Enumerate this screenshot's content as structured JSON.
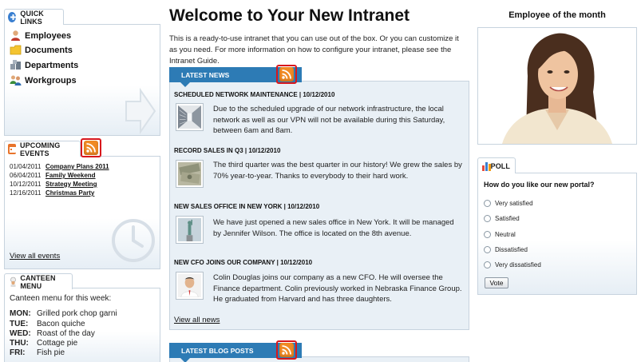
{
  "quick_links": {
    "title": "QUICK LINKS",
    "items": [
      {
        "label": "Employees",
        "icon": "user-icon"
      },
      {
        "label": "Documents",
        "icon": "folder-icon"
      },
      {
        "label": "Departments",
        "icon": "boxes-icon"
      },
      {
        "label": "Workgroups",
        "icon": "group-icon"
      }
    ]
  },
  "upcoming_events": {
    "title": "UPCOMING EVENTS",
    "items": [
      {
        "date": "01/04/2011",
        "title": "Company Plans 2011"
      },
      {
        "date": "06/04/2011",
        "title": "Family Weekend"
      },
      {
        "date": "10/12/2011",
        "title": "Strategy Meeting"
      },
      {
        "date": "12/16/2011",
        "title": "Christmas Party"
      }
    ],
    "view_all": "View all events"
  },
  "canteen": {
    "title": "CANTEEN MENU",
    "intro": "Canteen menu for this week:",
    "items": [
      {
        "day": "MON:",
        "dish": "Grilled pork chop garni"
      },
      {
        "day": "TUE:",
        "dish": "Bacon quiche"
      },
      {
        "day": "WED:",
        "dish": "Roast of the day"
      },
      {
        "day": "THU:",
        "dish": "Cottage pie"
      },
      {
        "day": "FRI:",
        "dish": "Fish pie"
      }
    ]
  },
  "main": {
    "title": "Welcome to Your New Intranet",
    "intro": "This is a ready-to-use intranet that you can use out of the box. Or you can customize it as you need. For more information on how to configure your intranet, please see the Intranet Guide."
  },
  "latest_news": {
    "title": "LATEST NEWS",
    "items": [
      {
        "heading": "SCHEDULED NETWORK MAINTENANCE | 10/12/2010",
        "body": "Due to the scheduled upgrade of our network infrastructure, the local network as well as our VPN will not be available during this Saturday, between 6am and 8am."
      },
      {
        "heading": "RECORD SALES IN Q3 | 10/12/2010",
        "body": "The third quarter was the best quarter in our history! We grew the sales by 70% year-to-year. Thanks to everybody to their hard work."
      },
      {
        "heading": "NEW SALES OFFICE IN NEW YORK | 10/12/2010",
        "body": "We have just opened a new sales office in New York. It will be managed by Jennifer Wilson. The office is located on the 8th avenue."
      },
      {
        "heading": "NEW CFO JOINS OUR COMPANY | 10/12/2010",
        "body": "Colin Douglas joins our company as a new CFO. He will oversee the Finance department. Colin previously worked in Nebraska Finance Group. He graduated from Harvard and has three daughters."
      }
    ],
    "view_all": "View all news"
  },
  "latest_blog_posts": {
    "title": "LATEST BLOG POSTS"
  },
  "employee_of_month": {
    "title": "Employee of the month"
  },
  "poll": {
    "title": "POLL",
    "question": "How do you like our new portal?",
    "options": [
      "Very satisfied",
      "Satisfied",
      "Neutral",
      "Dissatisfied",
      "Very dissatisfied"
    ],
    "vote_label": "Vote"
  },
  "colors": {
    "accent_blue": "#2d7bb5",
    "rss_orange": "#f08a24",
    "highlight_red": "#d8171c",
    "panel_border": "#c7d3de"
  }
}
